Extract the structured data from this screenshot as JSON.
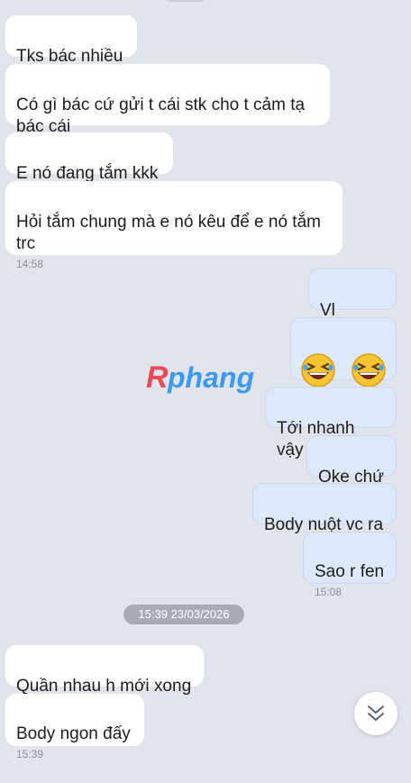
{
  "messages": [
    {
      "text": "Tks bác nhiều"
    },
    {
      "text": "Có gì bác cứ gửi t cái stk cho t cảm tạ\nbác cái"
    },
    {
      "text": "E nó đang tắm kkk"
    },
    {
      "text": "Hỏi tắm chung mà e nó kêu để e nó tắm\ntrc",
      "time": "14:58"
    },
    {
      "text": "Vl"
    },
    {
      "text": "Tới nhanh vậy"
    },
    {
      "text": "Oke chứ"
    },
    {
      "text": "Body nuột vc ra"
    },
    {
      "text": "Sao r fen",
      "time": "15:08"
    },
    {
      "text": "Quần nhau h mới xong"
    },
    {
      "text": "Body ngon đấy",
      "time": "15:39"
    }
  ],
  "emoji_message": {
    "emoji": [
      "grinning-squinting-face",
      "grinning-squinting-face"
    ]
  },
  "date_separator": "15:39 23/03/2026",
  "watermark": "Rphang",
  "colors": {
    "background": "#e2e4ec",
    "incoming_bubble": "#ffffff",
    "outgoing_bubble": "#dde9fb",
    "watermark_red": "#e8323c",
    "watermark_blue": "#1e8cf0"
  },
  "icons": {
    "scroll_down": "double-chevron-down-icon"
  }
}
